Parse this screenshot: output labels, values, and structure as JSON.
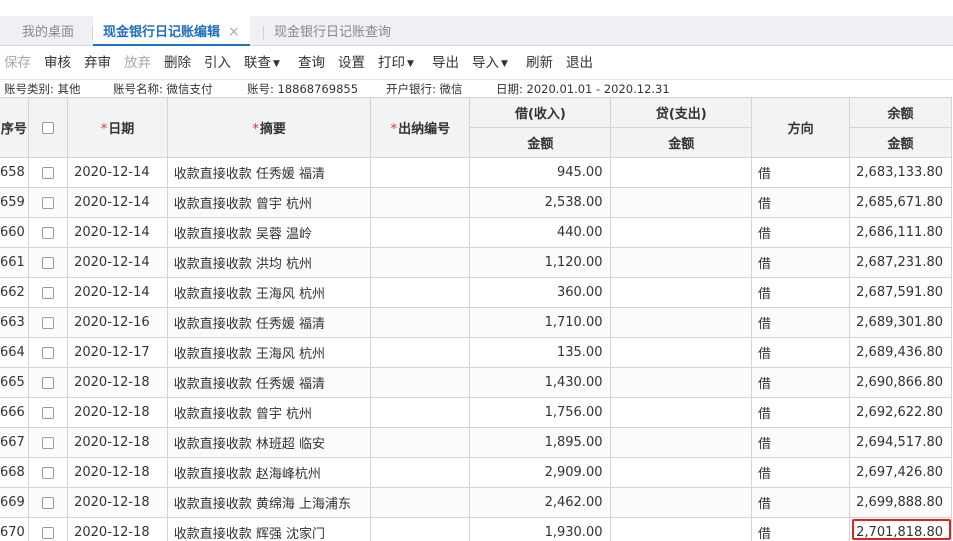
{
  "tabs": [
    {
      "label": "我的桌面",
      "active": false
    },
    {
      "label": "现金银行日记账编辑",
      "active": true,
      "closable": true
    },
    {
      "label": "现金银行日记账查询",
      "active": false
    }
  ],
  "tab_close_glyph": "×",
  "toolbar": [
    {
      "label": "保存",
      "disabled": true,
      "menu": false
    },
    {
      "label": "审核",
      "disabled": false,
      "menu": false
    },
    {
      "label": "弃审",
      "disabled": false,
      "menu": false
    },
    {
      "label": "放弃",
      "disabled": true,
      "menu": false
    },
    {
      "label": "删除",
      "disabled": false,
      "menu": false
    },
    {
      "label": "引入",
      "disabled": false,
      "menu": false
    },
    {
      "label": "联查",
      "disabled": false,
      "menu": true
    },
    {
      "label": "查询",
      "disabled": false,
      "menu": false
    },
    {
      "label": "设置",
      "disabled": false,
      "menu": false
    },
    {
      "label": "打印",
      "disabled": false,
      "menu": true
    },
    {
      "label": "导出",
      "disabled": false,
      "menu": false
    },
    {
      "label": "导入",
      "disabled": false,
      "menu": true
    },
    {
      "label": "刷新",
      "disabled": false,
      "menu": false
    },
    {
      "label": "退出",
      "disabled": false,
      "menu": false
    }
  ],
  "info": {
    "account_type": "账号类别: 其他",
    "account_name": "账号名称: 微信支付",
    "account_no": "账号: 18868769855",
    "bank": "开户银行: 微信",
    "date_range": "日期: 2020.01.01 - 2020.12.31"
  },
  "headers": {
    "seq": "序号",
    "date": "日期",
    "summary": "摘要",
    "voucher": "出纳编号",
    "debit": "借(收入)",
    "credit": "贷(支出)",
    "direction": "方向",
    "balance": "余额",
    "amount": "金额",
    "required_mark": "*"
  },
  "rows": [
    {
      "seq": "658",
      "date": "2020-12-14",
      "summary": "收款直接收款 任秀媛 福清",
      "voucher": "",
      "debit": "945.00",
      "credit": "",
      "direction": "借",
      "balance": "2,683,133.80"
    },
    {
      "seq": "659",
      "date": "2020-12-14",
      "summary": "收款直接收款 曾宇 杭州",
      "voucher": "",
      "debit": "2,538.00",
      "credit": "",
      "direction": "借",
      "balance": "2,685,671.80"
    },
    {
      "seq": "660",
      "date": "2020-12-14",
      "summary": "收款直接收款 吴蓉 温岭",
      "voucher": "",
      "debit": "440.00",
      "credit": "",
      "direction": "借",
      "balance": "2,686,111.80"
    },
    {
      "seq": "661",
      "date": "2020-12-14",
      "summary": "收款直接收款 洪均 杭州",
      "voucher": "",
      "debit": "1,120.00",
      "credit": "",
      "direction": "借",
      "balance": "2,687,231.80"
    },
    {
      "seq": "662",
      "date": "2020-12-14",
      "summary": "收款直接收款 王海风 杭州",
      "voucher": "",
      "debit": "360.00",
      "credit": "",
      "direction": "借",
      "balance": "2,687,591.80"
    },
    {
      "seq": "663",
      "date": "2020-12-16",
      "summary": "收款直接收款 任秀媛 福清",
      "voucher": "",
      "debit": "1,710.00",
      "credit": "",
      "direction": "借",
      "balance": "2,689,301.80"
    },
    {
      "seq": "664",
      "date": "2020-12-17",
      "summary": "收款直接收款 王海风 杭州",
      "voucher": "",
      "debit": "135.00",
      "credit": "",
      "direction": "借",
      "balance": "2,689,436.80"
    },
    {
      "seq": "665",
      "date": "2020-12-18",
      "summary": "收款直接收款 任秀媛 福清",
      "voucher": "",
      "debit": "1,430.00",
      "credit": "",
      "direction": "借",
      "balance": "2,690,866.80"
    },
    {
      "seq": "666",
      "date": "2020-12-18",
      "summary": "收款直接收款 曾宇 杭州",
      "voucher": "",
      "debit": "1,756.00",
      "credit": "",
      "direction": "借",
      "balance": "2,692,622.80"
    },
    {
      "seq": "667",
      "date": "2020-12-18",
      "summary": "收款直接收款 林班超 临安",
      "voucher": "",
      "debit": "1,895.00",
      "credit": "",
      "direction": "借",
      "balance": "2,694,517.80"
    },
    {
      "seq": "668",
      "date": "2020-12-18",
      "summary": "收款直接收款 赵海峰杭州",
      "voucher": "",
      "debit": "2,909.00",
      "credit": "",
      "direction": "借",
      "balance": "2,697,426.80"
    },
    {
      "seq": "669",
      "date": "2020-12-18",
      "summary": "收款直接收款 黄绵海 上海浦东",
      "voucher": "",
      "debit": "2,462.00",
      "credit": "",
      "direction": "借",
      "balance": "2,699,888.80"
    },
    {
      "seq": "670",
      "date": "2020-12-18",
      "summary": "收款直接收款 辉强 沈家门",
      "voucher": "",
      "debit": "1,930.00",
      "credit": "",
      "direction": "借",
      "balance": "2,701,818.80",
      "highlighted": true
    }
  ],
  "colors": {
    "accent": "#1f6fc1",
    "required": "#e03131",
    "highlight_border": "#e0231e"
  }
}
